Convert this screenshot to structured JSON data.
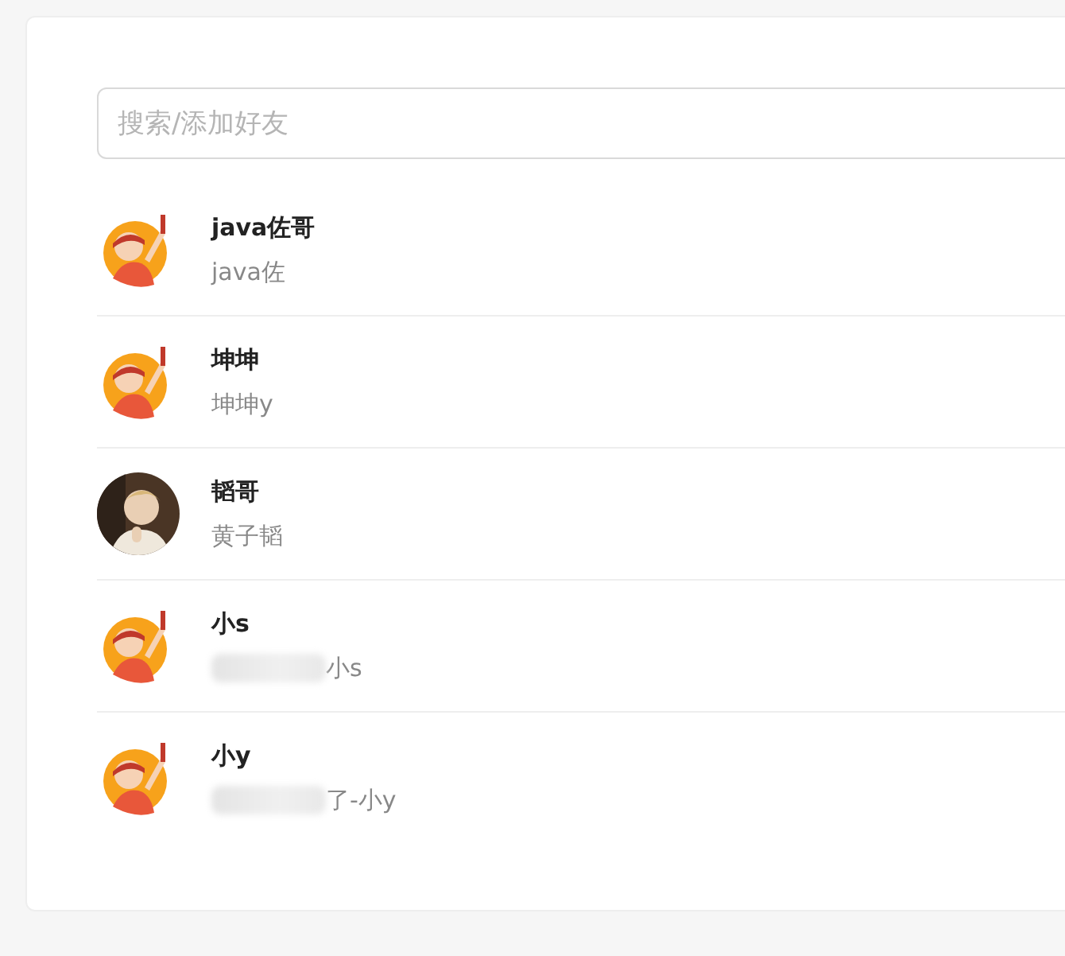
{
  "search": {
    "placeholder": "搜索/添加好友"
  },
  "friends": [
    {
      "name": "java佐哥",
      "note": "java佐",
      "kind": "cartoon",
      "redacted": false
    },
    {
      "name": "坤坤",
      "note": "坤坤y",
      "kind": "cartoon",
      "redacted": false
    },
    {
      "name": "韬哥",
      "note": "黄子韬",
      "redacted": false
    },
    {
      "name": "小s",
      "note": "小s",
      "kind": "cartoon",
      "redacted": true
    },
    {
      "name": "小y",
      "note": "了-小y",
      "kind": "cartoon",
      "redacted": true
    }
  ]
}
